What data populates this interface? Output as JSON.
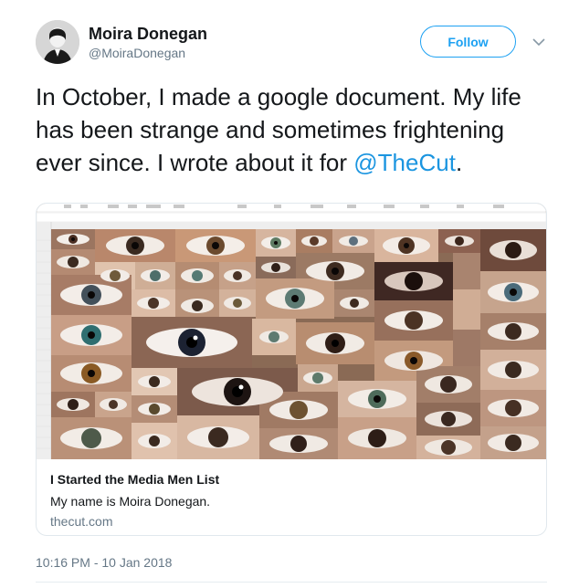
{
  "author": {
    "name": "Moira Donegan",
    "handle": "@MoiraDonegan"
  },
  "follow_label": "Follow",
  "tweet": {
    "text": "In October, I made a google document. My life has been strange and sometimes frightening ever since. I wrote about it for ",
    "mention": "@TheCut",
    "trailing": "."
  },
  "card": {
    "title": "I Started the Media Men List",
    "description": "My name is Moira Donegan.",
    "domain": "thecut.com"
  },
  "timestamp": "10:16 PM - 10 Jan 2018",
  "colors": {
    "link": "#1b95e0",
    "follow": "#1da1f2",
    "secondary_text": "#657786"
  },
  "icons": [
    "chevron-down-icon"
  ]
}
